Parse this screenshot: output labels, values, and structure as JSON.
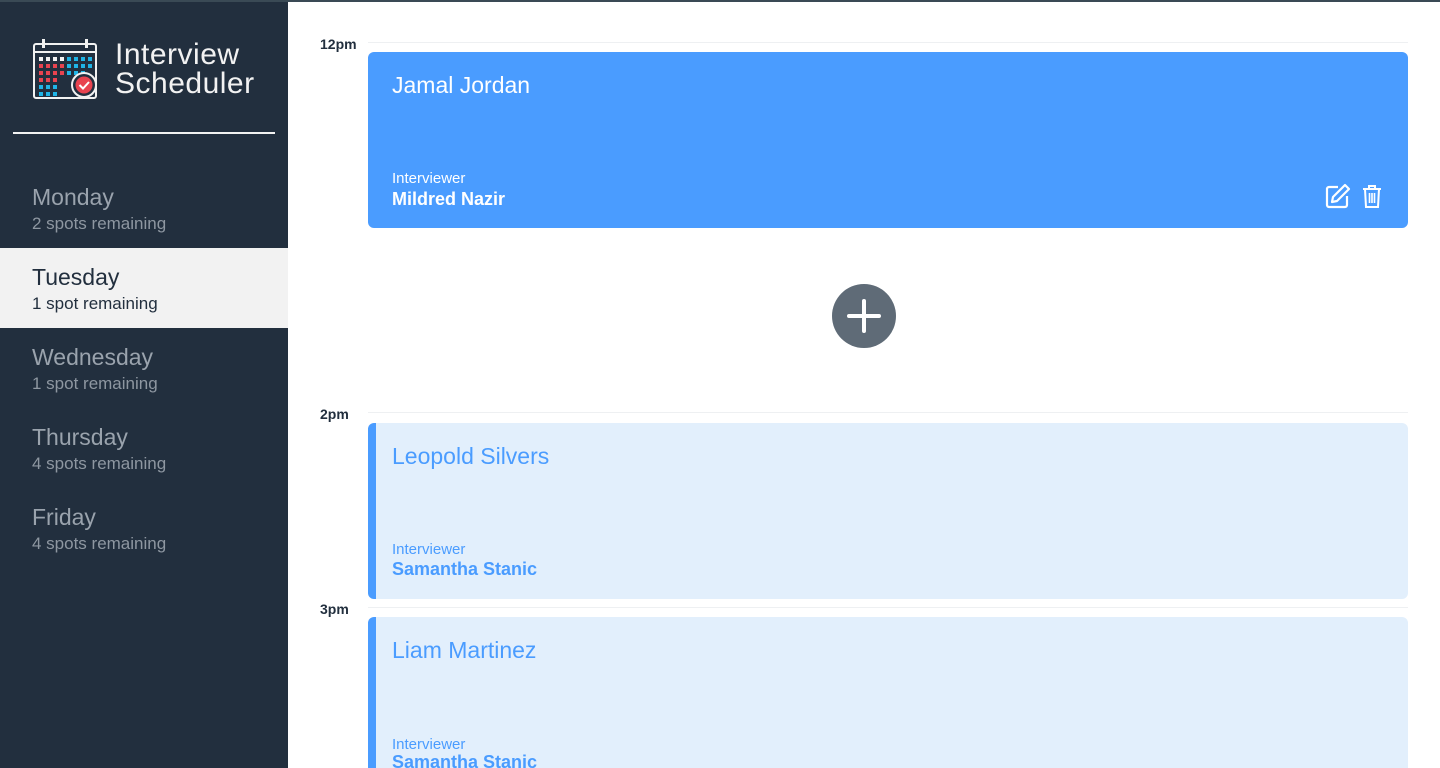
{
  "app": {
    "title_line1": "Interview",
    "title_line2": "Scheduler"
  },
  "days": [
    {
      "name": "Monday",
      "spots": "2 spots remaining",
      "selected": false
    },
    {
      "name": "Tuesday",
      "spots": "1 spot remaining",
      "selected": true
    },
    {
      "name": "Wednesday",
      "spots": "1 spot remaining",
      "selected": false
    },
    {
      "name": "Thursday",
      "spots": "4 spots remaining",
      "selected": false
    },
    {
      "name": "Friday",
      "spots": "4 spots remaining",
      "selected": false
    }
  ],
  "schedule": {
    "slots": [
      {
        "time": "12pm",
        "student": "Jamal Jordan",
        "interviewer_label": "Interviewer",
        "interviewer": "Mildred Nazir"
      },
      {
        "time": "2pm",
        "student": "Leopold Silvers",
        "interviewer_label": "Interviewer",
        "interviewer": "Samantha Stanic"
      },
      {
        "time": "3pm",
        "student": "Liam Martinez",
        "interviewer_label": "Interviewer",
        "interviewer": "Samantha Stanic"
      }
    ]
  },
  "icons": {
    "logo": "calendar-check-icon",
    "edit": "edit-icon",
    "delete": "trash-icon",
    "add": "plus-icon"
  },
  "colors": {
    "sidebar": "#222f3e",
    "accent": "#4a9cff",
    "appointment_light": "#e2effc",
    "selected_day": "#f2f2f2",
    "add_button": "#5f6b77"
  }
}
